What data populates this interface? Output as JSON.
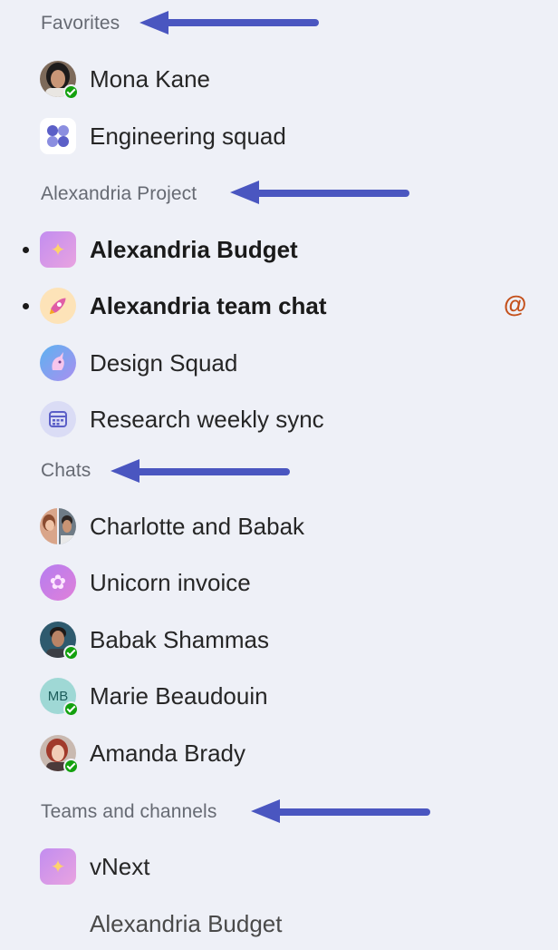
{
  "sections": {
    "favorites": "Favorites",
    "project": "Alexandria Project",
    "chats": "Chats",
    "teams": "Teams and channels"
  },
  "favorites": [
    {
      "label": "Mona Kane",
      "icon": "person-avatar"
    },
    {
      "label": "Engineering squad",
      "icon": "group-grid-icon"
    }
  ],
  "project": [
    {
      "label": "Alexandria Budget",
      "icon": "sparkle-icon",
      "unread": true
    },
    {
      "label": "Alexandria team chat",
      "icon": "rocket-icon",
      "unread": true,
      "mention": "@"
    },
    {
      "label": "Design Squad",
      "icon": "unicorn-icon"
    },
    {
      "label": "Research weekly sync",
      "icon": "calendar-icon"
    }
  ],
  "chats": [
    {
      "label": "Charlotte and Babak",
      "icon": "group-avatar"
    },
    {
      "label": "Unicorn invoice",
      "icon": "flower-icon"
    },
    {
      "label": "Babak Shammas",
      "icon": "person-avatar"
    },
    {
      "label": "Marie Beaudouin",
      "icon": "initials-avatar",
      "initials": "MB"
    },
    {
      "label": "Amanda Brady",
      "icon": "person-avatar"
    }
  ],
  "teams": [
    {
      "label": "vNext",
      "icon": "sparkle-icon"
    },
    {
      "label": "Alexandria Budget"
    }
  ],
  "colors": {
    "background": "#eef0f7",
    "arrow": "#4a56c0",
    "presence": "#13a10e",
    "mention": "#c4501b"
  }
}
